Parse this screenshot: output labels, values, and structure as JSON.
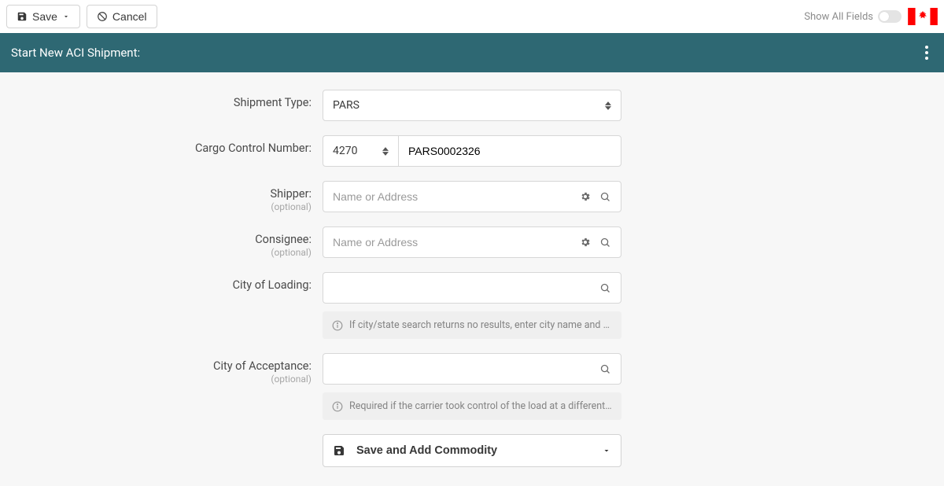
{
  "toolbar": {
    "save_label": "Save",
    "cancel_label": "Cancel",
    "show_all_label": "Show All Fields"
  },
  "header": {
    "title": "Start New ACI Shipment:"
  },
  "form": {
    "shipment_type": {
      "label": "Shipment Type:",
      "selected": "PARS"
    },
    "ccn": {
      "label": "Cargo Control Number:",
      "prefix": "4270",
      "value": "PARS0002326"
    },
    "shipper": {
      "label": "Shipper:",
      "optional": "(optional)",
      "placeholder": "Name or Address"
    },
    "consignee": {
      "label": "Consignee:",
      "optional": "(optional)",
      "placeholder": "Name or Address"
    },
    "city_loading": {
      "label": "City of Loading:",
      "hint": "If city/state search returns no results, enter city name and stat..."
    },
    "city_acceptance": {
      "label": "City of Acceptance:",
      "optional": "(optional)",
      "hint": "Required if the carrier took control of the load at a different ad..."
    },
    "action": {
      "label": "Save and Add Commodity"
    }
  }
}
